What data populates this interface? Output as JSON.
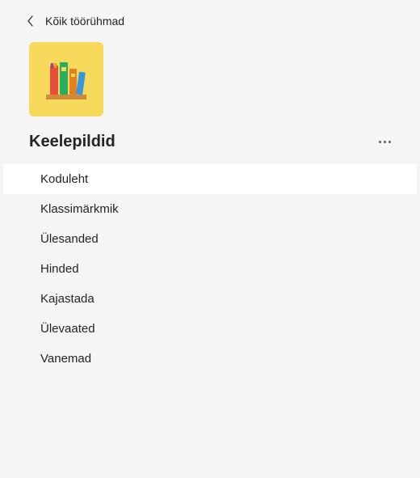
{
  "header": {
    "back_label": "Kõik töörühmad"
  },
  "team": {
    "title": "Keelepildid"
  },
  "channels": [
    {
      "label": "Koduleht",
      "selected": true
    },
    {
      "label": "Klassimärkmik",
      "selected": false
    },
    {
      "label": "Ülesanded",
      "selected": false
    },
    {
      "label": "Hinded",
      "selected": false
    },
    {
      "label": "Kajastada",
      "selected": false
    },
    {
      "label": "Ülevaated",
      "selected": false
    },
    {
      "label": "Vanemad",
      "selected": false
    }
  ]
}
